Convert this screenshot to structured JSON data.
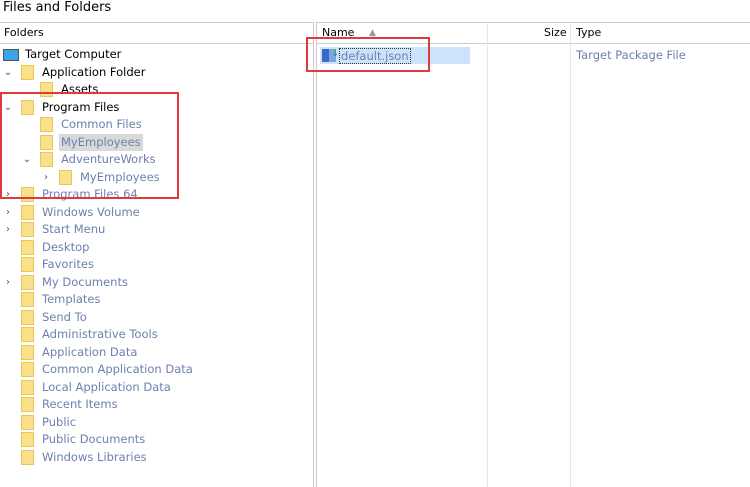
{
  "title": "Files and Folders",
  "folders_header": "Folders",
  "tree": [
    {
      "label": "Target Computer",
      "level": 0,
      "chev": "",
      "color": "blk",
      "icon": "computer-icon"
    },
    {
      "label": "Application Folder",
      "level": 0,
      "chev": "expanded",
      "color": "blk"
    },
    {
      "label": "Assets",
      "level": 1,
      "chev": "",
      "color": "blk"
    },
    {
      "label": "Program Files",
      "level": 0,
      "chev": "expanded",
      "color": "blk"
    },
    {
      "label": "Common Files",
      "level": 1,
      "chev": "",
      "color": "blu"
    },
    {
      "label": "MyEmployees",
      "level": 1,
      "chev": "",
      "color": "blu",
      "selected": true
    },
    {
      "label": "AdventureWorks",
      "level": 1,
      "chev": "expanded",
      "color": "blu"
    },
    {
      "label": "MyEmployees",
      "level": 2,
      "chev": "collapsed",
      "color": "blu"
    },
    {
      "label": "Program Files 64",
      "level": 0,
      "chev": "collapsed",
      "color": "blu"
    },
    {
      "label": "Windows Volume",
      "level": 0,
      "chev": "collapsed",
      "color": "blu"
    },
    {
      "label": "Start Menu",
      "level": 0,
      "chev": "collapsed",
      "color": "blu"
    },
    {
      "label": "Desktop",
      "level": 0,
      "chev": "",
      "color": "blu"
    },
    {
      "label": "Favorites",
      "level": 0,
      "chev": "",
      "color": "blu"
    },
    {
      "label": "My Documents",
      "level": 0,
      "chev": "collapsed",
      "color": "blu"
    },
    {
      "label": "Templates",
      "level": 0,
      "chev": "",
      "color": "blu"
    },
    {
      "label": "Send To",
      "level": 0,
      "chev": "",
      "color": "blu"
    },
    {
      "label": "Administrative Tools",
      "level": 0,
      "chev": "",
      "color": "blu"
    },
    {
      "label": "Application Data",
      "level": 0,
      "chev": "",
      "color": "blu"
    },
    {
      "label": "Common Application Data",
      "level": 0,
      "chev": "",
      "color": "blu"
    },
    {
      "label": "Local Application Data",
      "level": 0,
      "chev": "",
      "color": "blu"
    },
    {
      "label": "Recent Items",
      "level": 0,
      "chev": "",
      "color": "blu"
    },
    {
      "label": "Public",
      "level": 0,
      "chev": "",
      "color": "blu"
    },
    {
      "label": "Public Documents",
      "level": 0,
      "chev": "",
      "color": "blu"
    },
    {
      "label": "Windows Libraries",
      "level": 0,
      "chev": "",
      "color": "blu"
    }
  ],
  "columns": {
    "name": "Name",
    "size": "Size",
    "type": "Type"
  },
  "files": [
    {
      "name": "default.json",
      "size": "",
      "type": "Target Package File"
    }
  ]
}
